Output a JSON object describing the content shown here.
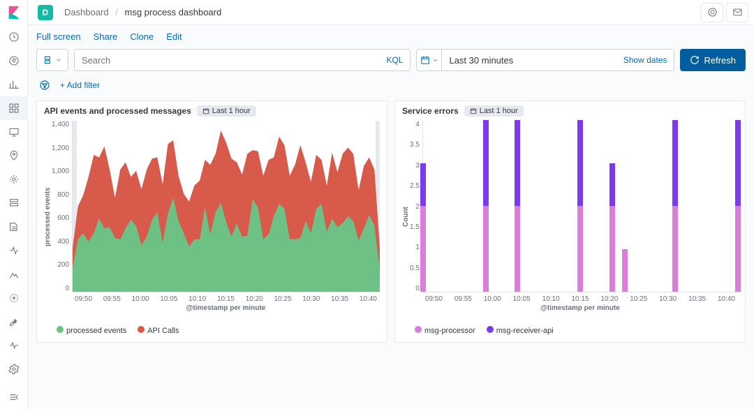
{
  "topbar": {
    "badge": "D",
    "breadcrumb_root": "Dashboard",
    "breadcrumb_sep": "/",
    "breadcrumb_current": "msg process dashboard"
  },
  "subbar": {
    "full_screen": "Full screen",
    "share": "Share",
    "clone": "Clone",
    "edit": "Edit"
  },
  "search": {
    "placeholder": "Search",
    "kql": "KQL"
  },
  "timepicker": {
    "label": "Last 30 minutes",
    "show_dates": "Show dates",
    "refresh": "Refresh"
  },
  "filter": {
    "add": "+ Add filter"
  },
  "panel1": {
    "title": "API events and processed messages",
    "badge": "Last 1 hour",
    "x_label": "@timestamp per minute",
    "y_label": "processed events",
    "legend": [
      "processed events",
      "API Calls"
    ]
  },
  "panel2": {
    "title": "Service errors",
    "badge": "Last 1 hour",
    "x_label": "@timestamp per minute",
    "y_label": "Count",
    "legend": [
      "msg-processor",
      "msg-receiver-api"
    ]
  },
  "colors": {
    "green": "#6ec184",
    "red": "#d75a4a",
    "purple": "#7c3aed",
    "pink": "#d97fd9"
  },
  "chart_data": [
    {
      "type": "area",
      "title": "API events and processed messages",
      "xlabel": "@timestamp per minute",
      "ylabel": "processed events",
      "ylim": [
        0,
        1400
      ],
      "x_ticks": [
        "09:50",
        "09:55",
        "10:00",
        "10:05",
        "10:10",
        "10:15",
        "10:20",
        "10:25",
        "10:30",
        "10:35",
        "10:40"
      ],
      "y_ticks": [
        1400,
        1200,
        1000,
        800,
        600,
        400,
        200,
        0
      ],
      "series": [
        {
          "name": "processed events",
          "color": "#6ec184",
          "values": [
            200,
            430,
            480,
            410,
            480,
            600,
            520,
            530,
            440,
            430,
            520,
            590,
            540,
            380,
            450,
            590,
            650,
            400,
            640,
            770,
            580,
            480,
            370,
            430,
            430,
            690,
            470,
            650,
            730,
            570,
            450,
            560,
            450,
            460,
            760,
            690,
            430,
            470,
            620,
            720,
            680,
            430,
            430,
            440,
            580,
            480,
            680,
            720,
            490,
            600,
            530,
            560,
            620,
            580,
            420,
            520,
            630,
            540,
            180
          ]
        },
        {
          "name": "API Calls",
          "color": "#d75a4a",
          "values": [
            360,
            700,
            790,
            940,
            1120,
            1100,
            1190,
            1000,
            770,
            1000,
            1060,
            940,
            990,
            840,
            1000,
            1090,
            1100,
            880,
            1210,
            1240,
            950,
            800,
            740,
            870,
            910,
            1080,
            1040,
            1130,
            1320,
            1220,
            1090,
            1060,
            960,
            1130,
            1160,
            1150,
            950,
            1080,
            1100,
            1270,
            1200,
            950,
            1040,
            1200,
            1060,
            900,
            1120,
            1080,
            870,
            1140,
            980,
            1130,
            1180,
            1130,
            830,
            1030,
            1100,
            1000,
            360
          ]
        }
      ]
    },
    {
      "type": "bar",
      "title": "Service errors",
      "xlabel": "@timestamp per minute",
      "ylabel": "Count",
      "ylim": [
        0,
        4
      ],
      "x_ticks": [
        "09:50",
        "09:55",
        "10:00",
        "10:05",
        "10:10",
        "10:15",
        "10:20",
        "10:25",
        "10:30",
        "10:35",
        "10:40"
      ],
      "y_ticks": [
        4,
        3.5,
        3,
        2.5,
        2,
        1.5,
        1,
        0.5,
        0
      ],
      "categories": [
        "09:50",
        "10:00",
        "10:05",
        "10:15",
        "10:20",
        "10:21",
        "10:30",
        "10:40"
      ],
      "series": [
        {
          "name": "msg-processor",
          "color": "#d97fd9",
          "values": [
            2,
            2,
            2,
            2,
            2,
            1,
            2,
            2
          ]
        },
        {
          "name": "msg-receiver-api",
          "color": "#7c3aed",
          "values": [
            1,
            2,
            2,
            2,
            1,
            0,
            2,
            2
          ]
        }
      ]
    }
  ]
}
